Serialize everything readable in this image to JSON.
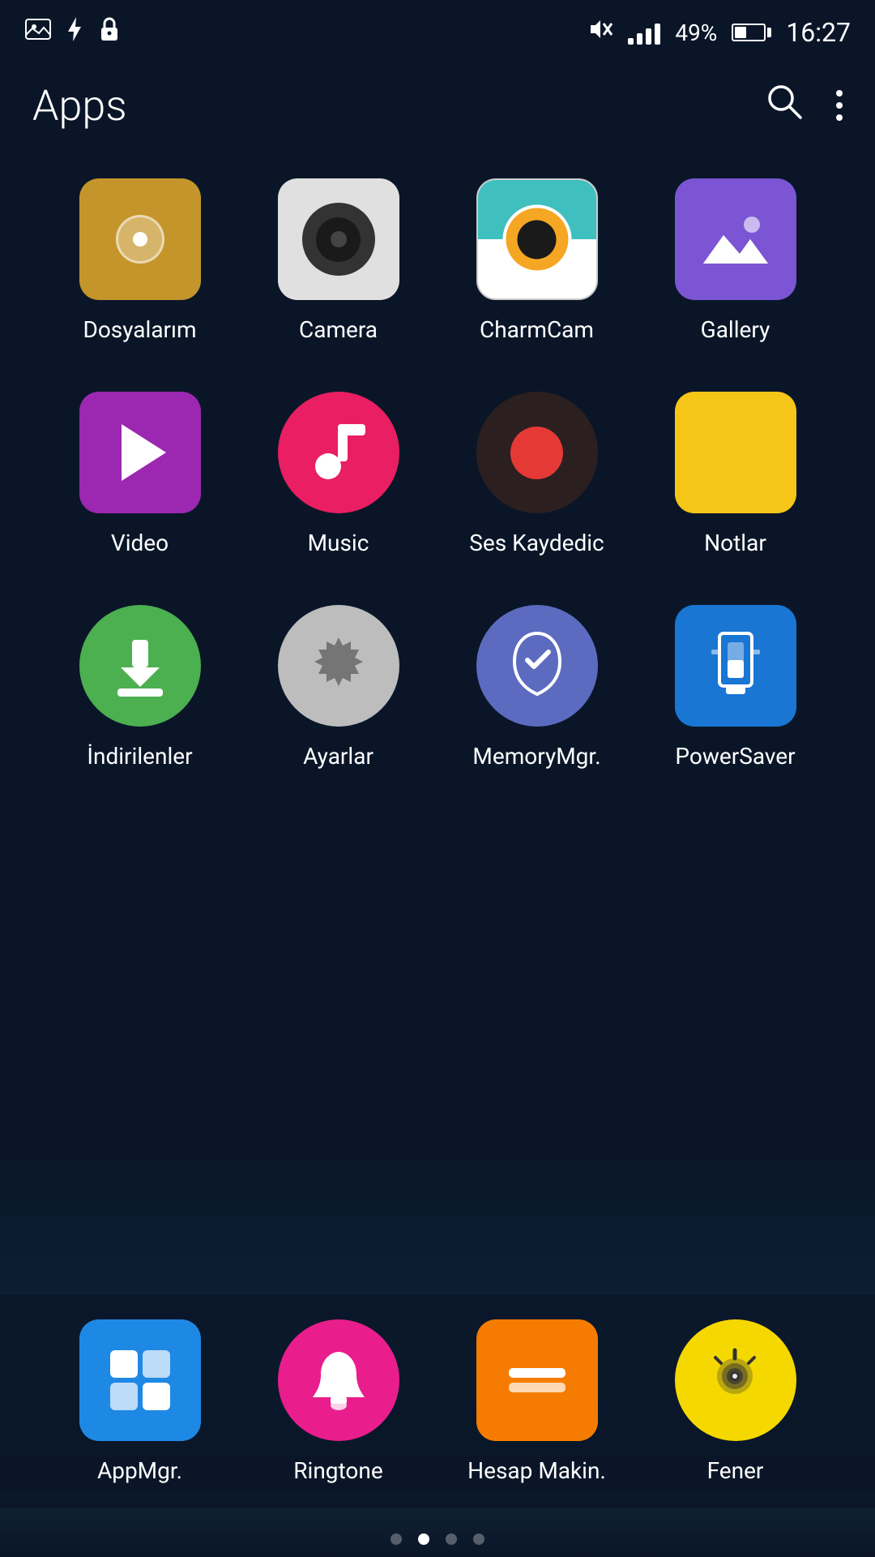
{
  "status_bar": {
    "time": "16:27",
    "battery_percent": "49%",
    "icons": [
      "image",
      "bolt",
      "lock"
    ]
  },
  "header": {
    "title": "Apps",
    "search_label": "Search",
    "more_label": "More options"
  },
  "apps": [
    {
      "id": "dosyalarim",
      "label": "Dosyalarım",
      "icon_type": "dosyalarim",
      "color": "#c4952a"
    },
    {
      "id": "camera",
      "label": "Camera",
      "icon_type": "camera",
      "color": "#e0e0e0"
    },
    {
      "id": "charmcam",
      "label": "CharmCam",
      "icon_type": "charmcam",
      "color": "#40bfbf"
    },
    {
      "id": "gallery",
      "label": "Gallery",
      "icon_type": "gallery",
      "color": "#7b55d4"
    },
    {
      "id": "video",
      "label": "Video",
      "icon_type": "video",
      "color": "#9c27b0"
    },
    {
      "id": "music",
      "label": "Music",
      "icon_type": "music",
      "color": "#e91e63"
    },
    {
      "id": "ses",
      "label": "Ses Kaydedic",
      "icon_type": "ses",
      "color": "#2c1f1f"
    },
    {
      "id": "notlar",
      "label": "Notlar",
      "icon_type": "notlar",
      "color": "#f5c518"
    },
    {
      "id": "indirilenler",
      "label": "İndirilenler",
      "icon_type": "indirilenler",
      "color": "#4caf50"
    },
    {
      "id": "ayarlar",
      "label": "Ayarlar",
      "icon_type": "ayarlar",
      "color": "#bdbdbd"
    },
    {
      "id": "memorymgr",
      "label": "MemoryMgr.",
      "icon_type": "memorymgr",
      "color": "#5c6bc0"
    },
    {
      "id": "powersaver",
      "label": "PowerSaver",
      "icon_type": "powersaver",
      "color": "#1976d2"
    }
  ],
  "bottom_apps": [
    {
      "id": "appmgr",
      "label": "AppMgr.",
      "icon_type": "appmgr",
      "color": "#1e88e5"
    },
    {
      "id": "ringtone",
      "label": "Ringtone",
      "icon_type": "ringtone",
      "color": "#e91e8c"
    },
    {
      "id": "hesap",
      "label": "Hesap Makin.",
      "icon_type": "hesap",
      "color": "#f57c00"
    },
    {
      "id": "fener",
      "label": "Fener",
      "icon_type": "fener",
      "color": "#f5d800"
    }
  ],
  "page_indicators": {
    "total": 4,
    "active": 1
  }
}
